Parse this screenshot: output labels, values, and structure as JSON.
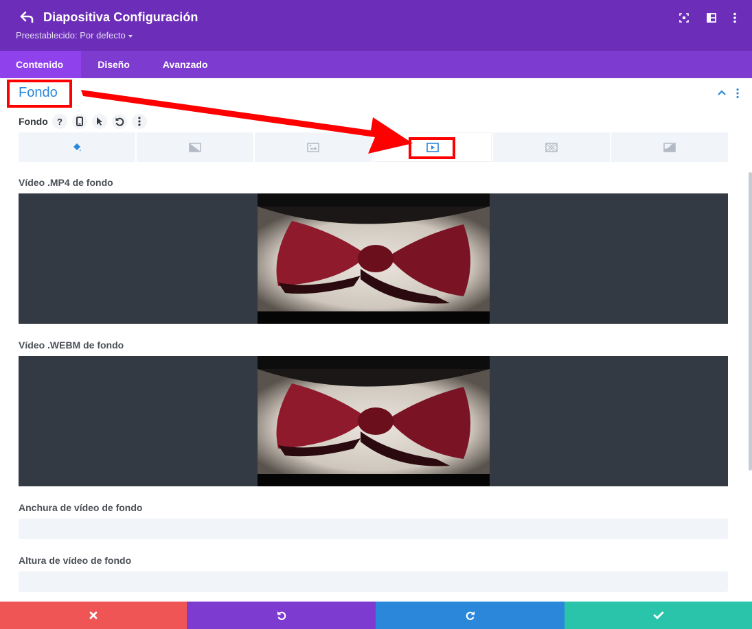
{
  "header": {
    "title": "Diapositiva Configuración",
    "preset_label": "Preestablecido: Por defecto",
    "icons": [
      "undo-arrow-icon",
      "expand-icon",
      "columns-layout-icon",
      "more-vertical-icon"
    ]
  },
  "tabs": [
    {
      "label": "Contenido",
      "active": true
    },
    {
      "label": "Diseño",
      "active": false
    },
    {
      "label": "Avanzado",
      "active": false
    }
  ],
  "section": {
    "title": "Fondo",
    "field_label": "Fondo",
    "field_icons": [
      "help-icon",
      "mobile-icon",
      "cursor-icon",
      "reset-icon",
      "more-icon"
    ],
    "bg_types": [
      {
        "icon": "paint-bucket-icon",
        "active": false
      },
      {
        "icon": "gradient-icon",
        "active": false
      },
      {
        "icon": "image-icon",
        "active": false
      },
      {
        "icon": "video-icon",
        "active": true
      },
      {
        "icon": "pattern-icon",
        "active": false
      },
      {
        "icon": "mask-icon",
        "active": false
      }
    ]
  },
  "fields": {
    "mp4_label": "Vídeo .MP4 de fondo",
    "webm_label": "Vídeo .WEBM de fondo",
    "width_label": "Anchura de vídeo de fondo",
    "width_value": "",
    "height_label": "Altura de vídeo de fondo",
    "height_value": ""
  },
  "footer": {
    "buttons": [
      "discard-icon",
      "undo-icon",
      "redo-icon",
      "save-check-icon"
    ]
  },
  "colors": {
    "header_bg": "#6c2eb9",
    "tabs_bg": "#7e3bd0",
    "accent_blue": "#2b87da",
    "annotation_red": "#ff0000",
    "discard": "#ef5555",
    "save": "#29c4a9"
  }
}
